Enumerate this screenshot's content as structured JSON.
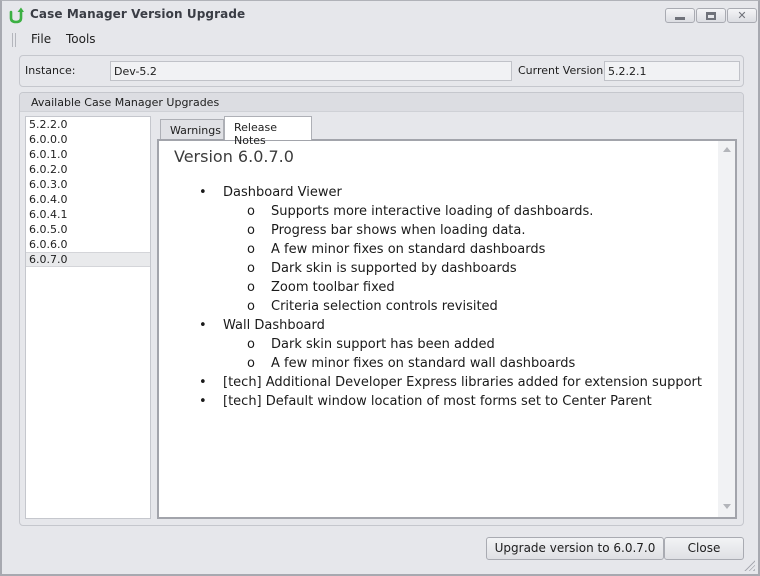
{
  "window": {
    "title": "Case Manager Version Upgrade",
    "app_icon": "upgrade-arrow-icon",
    "controls": {
      "minimize": "minimize-icon",
      "maximize": "maximize-icon",
      "close": "close-icon",
      "close_glyph": "✕"
    }
  },
  "menu": {
    "items": [
      {
        "label": "File"
      },
      {
        "label": "Tools"
      }
    ]
  },
  "instance": {
    "label": "Instance:",
    "value": "Dev-5.2",
    "current_version_label": "Current Version:",
    "current_version_value": "5.2.2.1"
  },
  "upgrades": {
    "title": "Available Case Manager Upgrades",
    "versions": [
      "5.2.2.0",
      "6.0.0.0",
      "6.0.1.0",
      "6.0.2.0",
      "6.0.3.0",
      "6.0.4.0",
      "6.0.4.1",
      "6.0.5.0",
      "6.0.6.0",
      "6.0.7.0"
    ],
    "selected_version": "6.0.7.0"
  },
  "tabs": [
    {
      "label": "Warnings",
      "active": false
    },
    {
      "label": "Release Notes",
      "active": true
    }
  ],
  "release_notes": {
    "title": "Version 6.0.7.0",
    "bullet_l1": "•",
    "bullet_l2": "o",
    "items": [
      {
        "level": 1,
        "text": "Dashboard Viewer"
      },
      {
        "level": 2,
        "text": "Supports more interactive loading of dashboards."
      },
      {
        "level": 2,
        "text": " Progress bar shows when loading data."
      },
      {
        "level": 2,
        "text": "A few minor fixes on standard dashboards"
      },
      {
        "level": 2,
        "text": "Dark skin is supported by dashboards"
      },
      {
        "level": 2,
        "text": "Zoom toolbar fixed"
      },
      {
        "level": 2,
        "text": "Criteria selection controls revisited"
      },
      {
        "level": 1,
        "text": "Wall Dashboard"
      },
      {
        "level": 2,
        "text": "Dark skin support has been added"
      },
      {
        "level": 2,
        "text": "A few minor fixes on standard wall dashboards"
      },
      {
        "level": 1,
        "text": "[tech] Additional Developer Express libraries added for extension support"
      },
      {
        "level": 1,
        "text": "[tech] Default window location of most forms set to Center Parent"
      }
    ]
  },
  "buttons": {
    "upgrade": "Upgrade version to 6.0.7.0",
    "close": "Close"
  },
  "colors": {
    "app_icon_green": "#3cb043",
    "window_bg": "#e6e7eb",
    "border": "#a7a9b0"
  }
}
